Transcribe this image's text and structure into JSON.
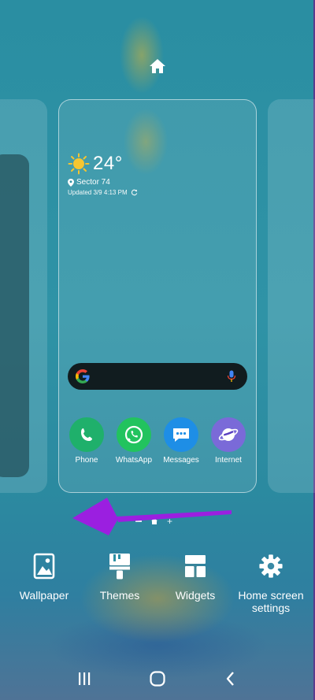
{
  "weather": {
    "temperature": "24°",
    "location": "Sector 74",
    "updated": "Updated 3/9 4:13 PM",
    "icon": "sun-icon"
  },
  "search": {
    "logo": "google-g-icon",
    "mic": "mic-icon"
  },
  "apps": [
    {
      "label": "Phone",
      "icon": "phone-icon",
      "color": "#1fb06b"
    },
    {
      "label": "WhatsApp",
      "icon": "whatsapp-icon",
      "color": "#22c35e"
    },
    {
      "label": "Messages",
      "icon": "messages-icon",
      "color": "#1e8ee6"
    },
    {
      "label": "Internet",
      "icon": "internet-icon",
      "color": "#7a6ad8"
    }
  ],
  "page_indicator": {
    "minus": "–",
    "plus": "+"
  },
  "menu": {
    "wallpaper": "Wallpaper",
    "themes": "Themes",
    "widgets": "Widgets",
    "home_screen_settings": "Home screen settings"
  },
  "colors": {
    "arrow": "#9b1fe0",
    "background": "#2c8fa3"
  }
}
